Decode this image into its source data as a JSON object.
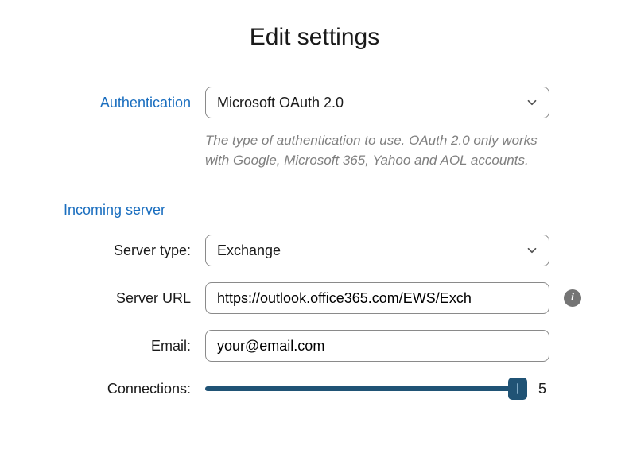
{
  "title": "Edit settings",
  "authentication": {
    "label": "Authentication",
    "selected": "Microsoft OAuth 2.0",
    "help": "The type of authentication to use. OAuth 2.0 only works with Google, Microsoft 365, Yahoo and AOL accounts."
  },
  "incoming": {
    "section_label": "Incoming server",
    "server_type": {
      "label": "Server type:",
      "selected": "Exchange"
    },
    "server_url": {
      "label": "Server URL",
      "value": "https://outlook.office365.com/EWS/Exch"
    },
    "email": {
      "label": "Email:",
      "value": "your@email.com"
    },
    "connections": {
      "label": "Connections:",
      "value": "5"
    }
  }
}
